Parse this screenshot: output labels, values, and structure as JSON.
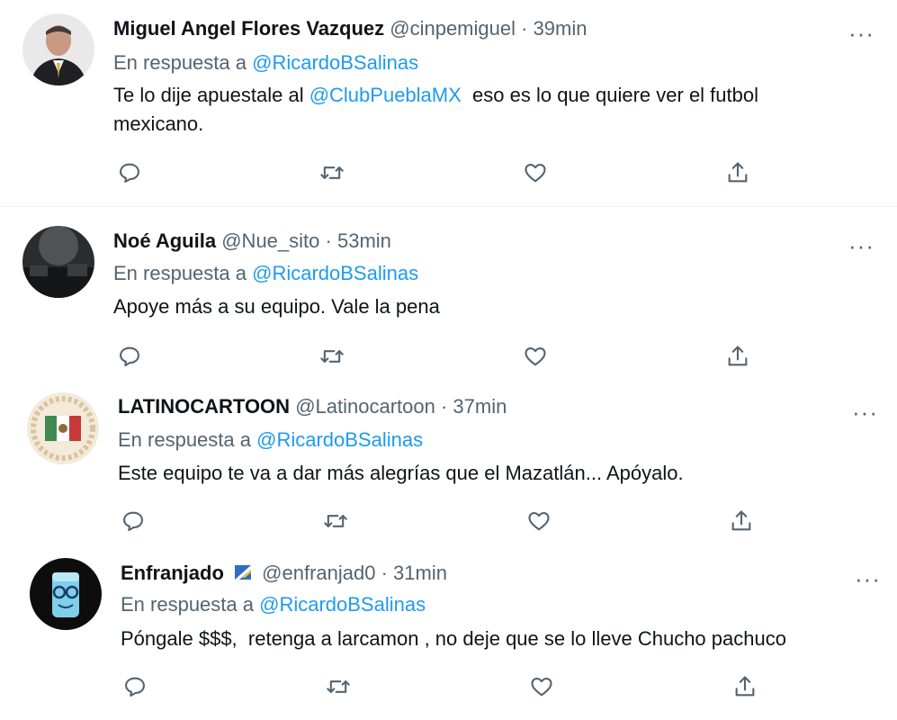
{
  "tweets": [
    {
      "name": "Miguel Angel Flores Vazquez",
      "handle": "@cinpemiguel",
      "sep": "·",
      "time": "39min",
      "reply_prefix": "En respuesta a",
      "reply_to": "@RicardoBSalinas",
      "text_line1_a": "Te lo dije apuestale al ",
      "text_line1_mention": "@ClubPueblaMX",
      "text_line1_b": "  eso es lo que quiere ver el futbol",
      "text_line2": "mexicano."
    },
    {
      "name": "Noé Aguila",
      "handle": "@Nue_sito",
      "sep": "·",
      "time": "53min",
      "reply_prefix": "En respuesta a",
      "reply_to": "@RicardoBSalinas",
      "text_line1": "Apoye más a su equipo. Vale la pena"
    },
    {
      "name": "LATINOCARTOON",
      "handle": "@Latinocartoon",
      "sep": "·",
      "time": "37min",
      "reply_prefix": "En respuesta a",
      "reply_to": "@RicardoBSalinas",
      "text_line1": "Este equipo te va a dar más alegrías que el Mazatlán... Apóyalo."
    },
    {
      "name": "Enfranjado",
      "handle": "@enfranjad0",
      "sep": "·",
      "time": "31min",
      "reply_prefix": "En respuesta a",
      "reply_to": "@RicardoBSalinas",
      "text_line1": "Póngale $$$,  retenga a larcamon , no deje que se lo lleve Chucho pachuco"
    }
  ],
  "more_label": "···",
  "icons": {
    "reply": "reply-icon",
    "retweet": "retweet-icon",
    "like": "like-icon",
    "share": "share-icon"
  },
  "colors": {
    "link": "#1d9bf0",
    "muted": "#536471",
    "text": "#0f1419"
  }
}
